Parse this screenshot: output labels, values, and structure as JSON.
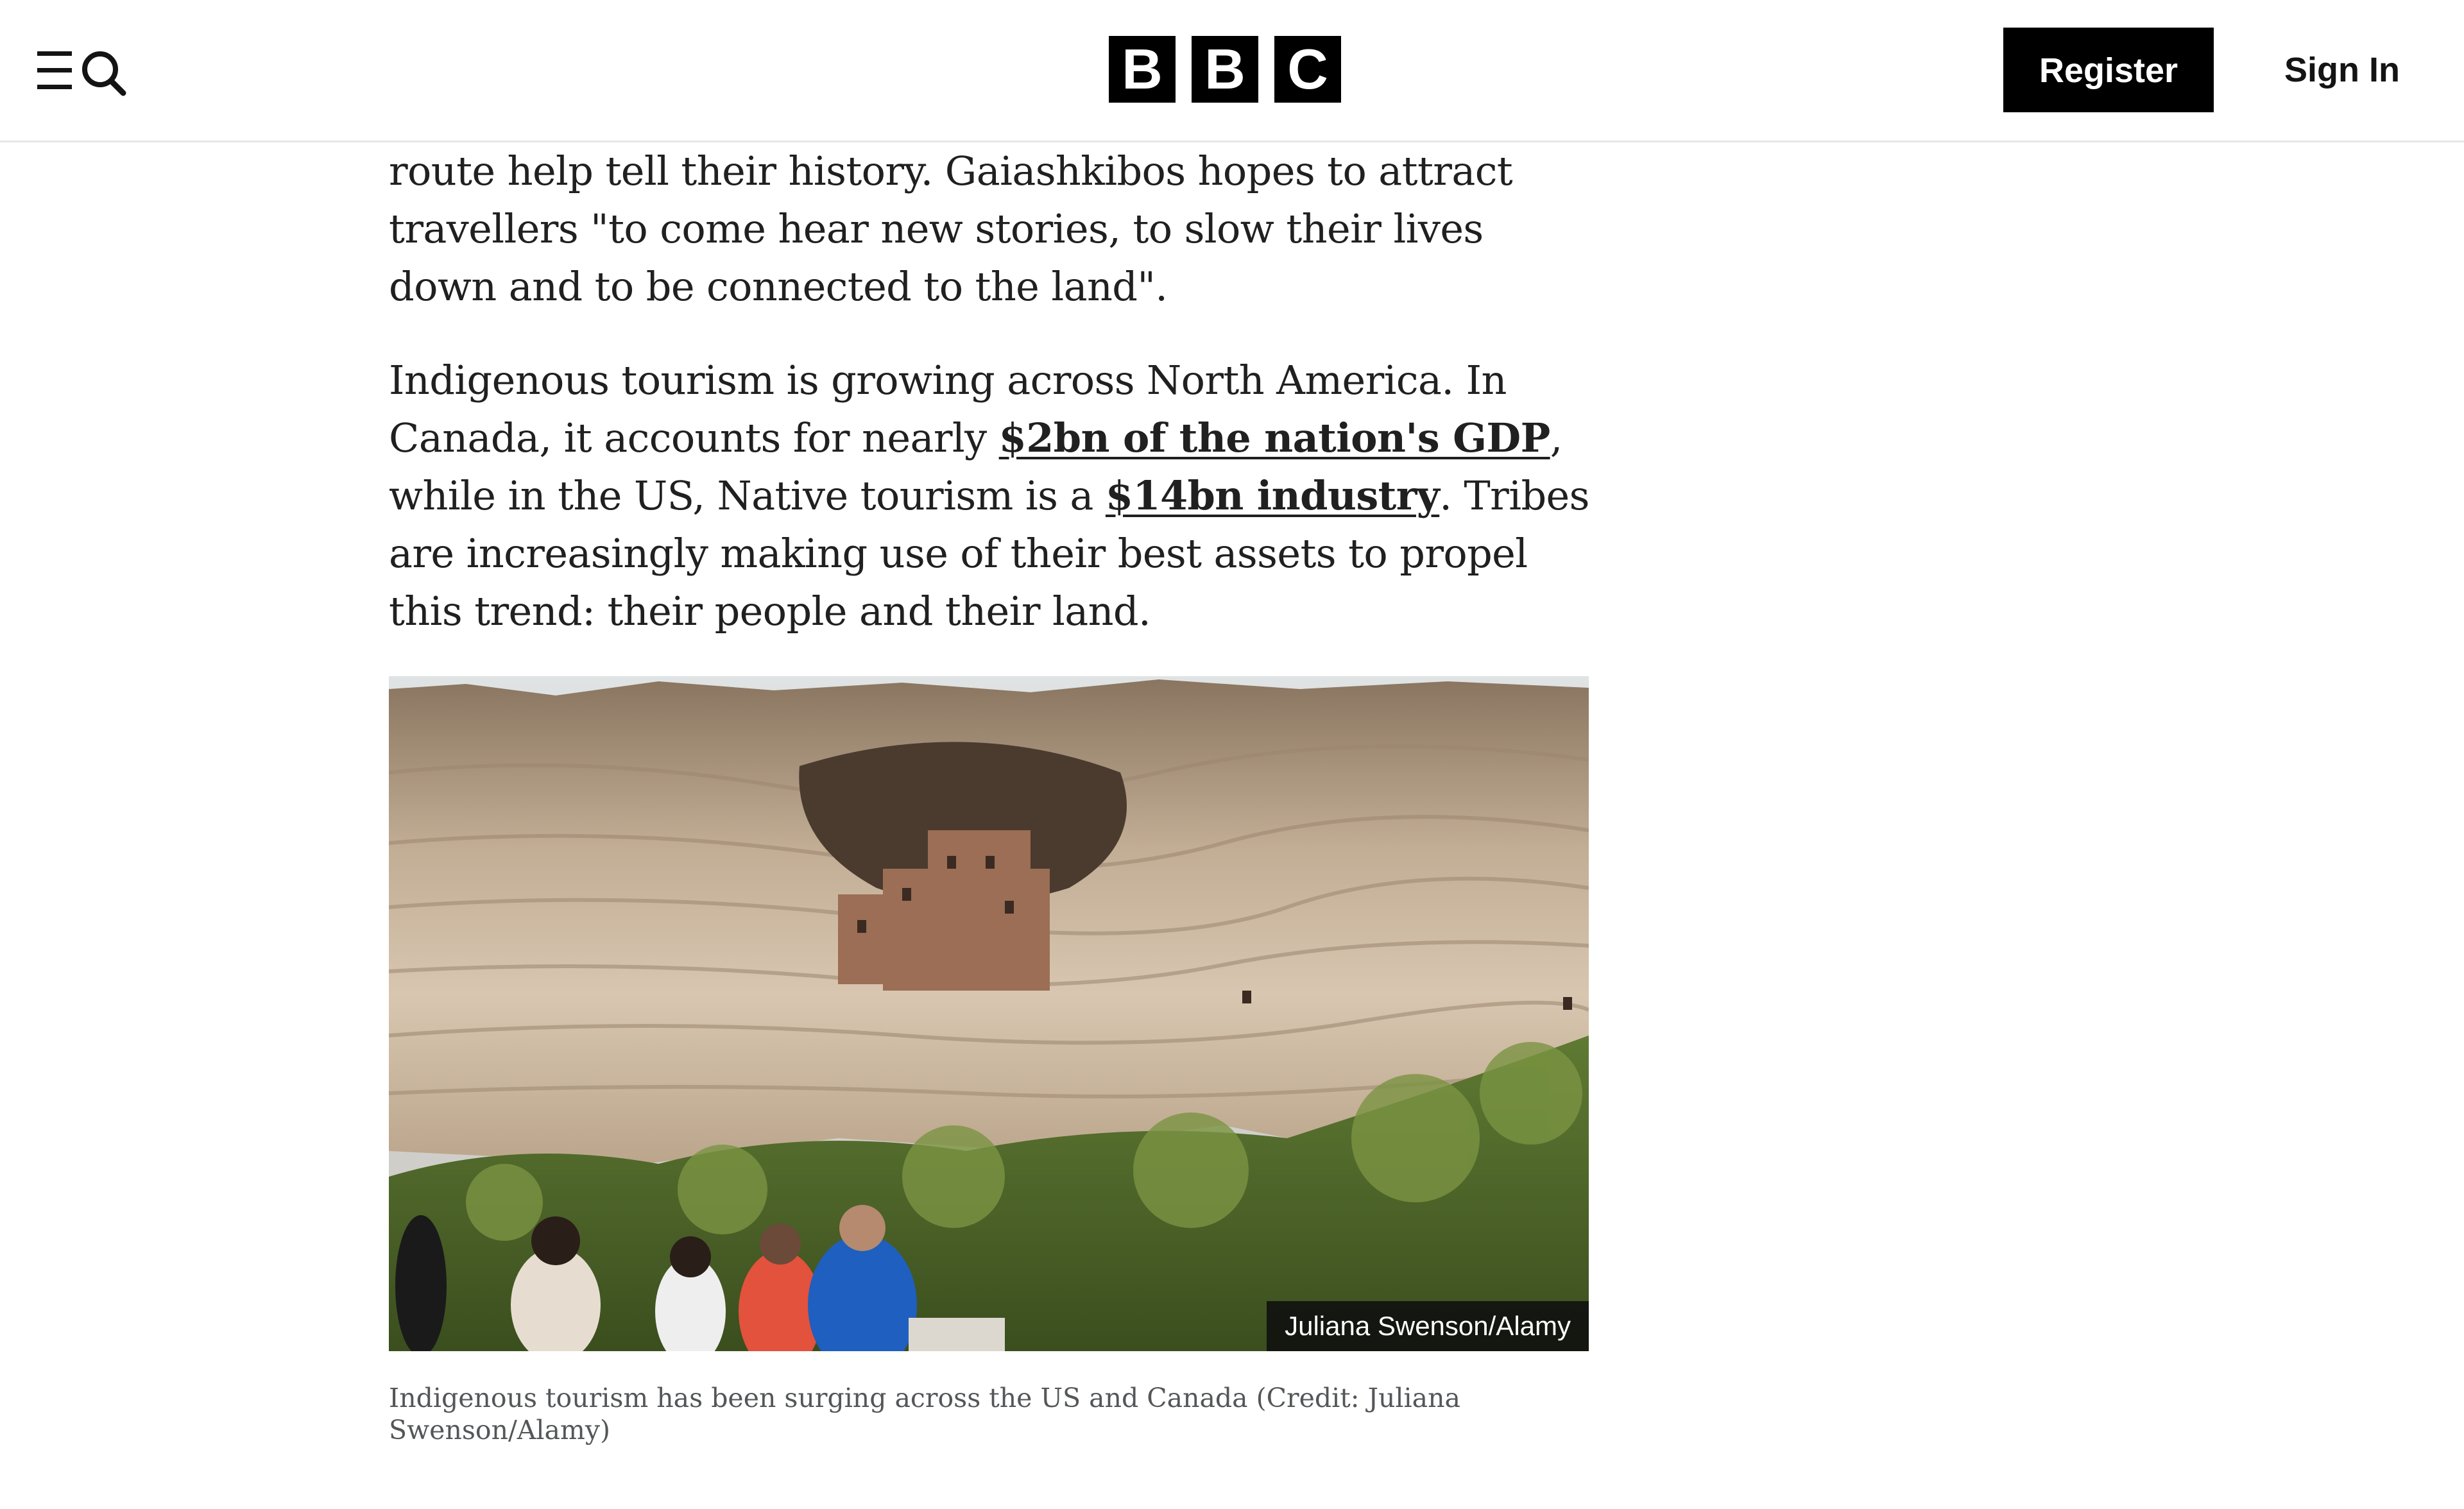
{
  "header": {
    "logo_letters": [
      "B",
      "B",
      "C"
    ],
    "register_label": "Register",
    "signin_label": "Sign In",
    "menu_icon": "menu-search-icon"
  },
  "article": {
    "para1": "route help tell their history. Gaiashkibos hopes to attract travellers \"to come hear new stories, to slow their lives down and to be connected to the land\".",
    "para2": {
      "text_a": "Indigenous tourism is growing across North America. In Canada, it accounts for nearly ",
      "link1": "$2bn of the nation's GDP",
      "text_b": ", while in the US, Native tourism is a ",
      "link2": "$14bn industry",
      "text_c": ". Tribes are increasingly making use of their best assets to propel this trend: their people and their land."
    },
    "image_credit": "Juliana Swenson/Alamy",
    "caption": "Indigenous tourism has been surging across the US and Canada (Credit: Juliana Swenson/Alamy)"
  },
  "colors": {
    "brand_black": "#000000",
    "text": "#202020",
    "caption": "#545658",
    "divider": "#e6e6e6"
  }
}
